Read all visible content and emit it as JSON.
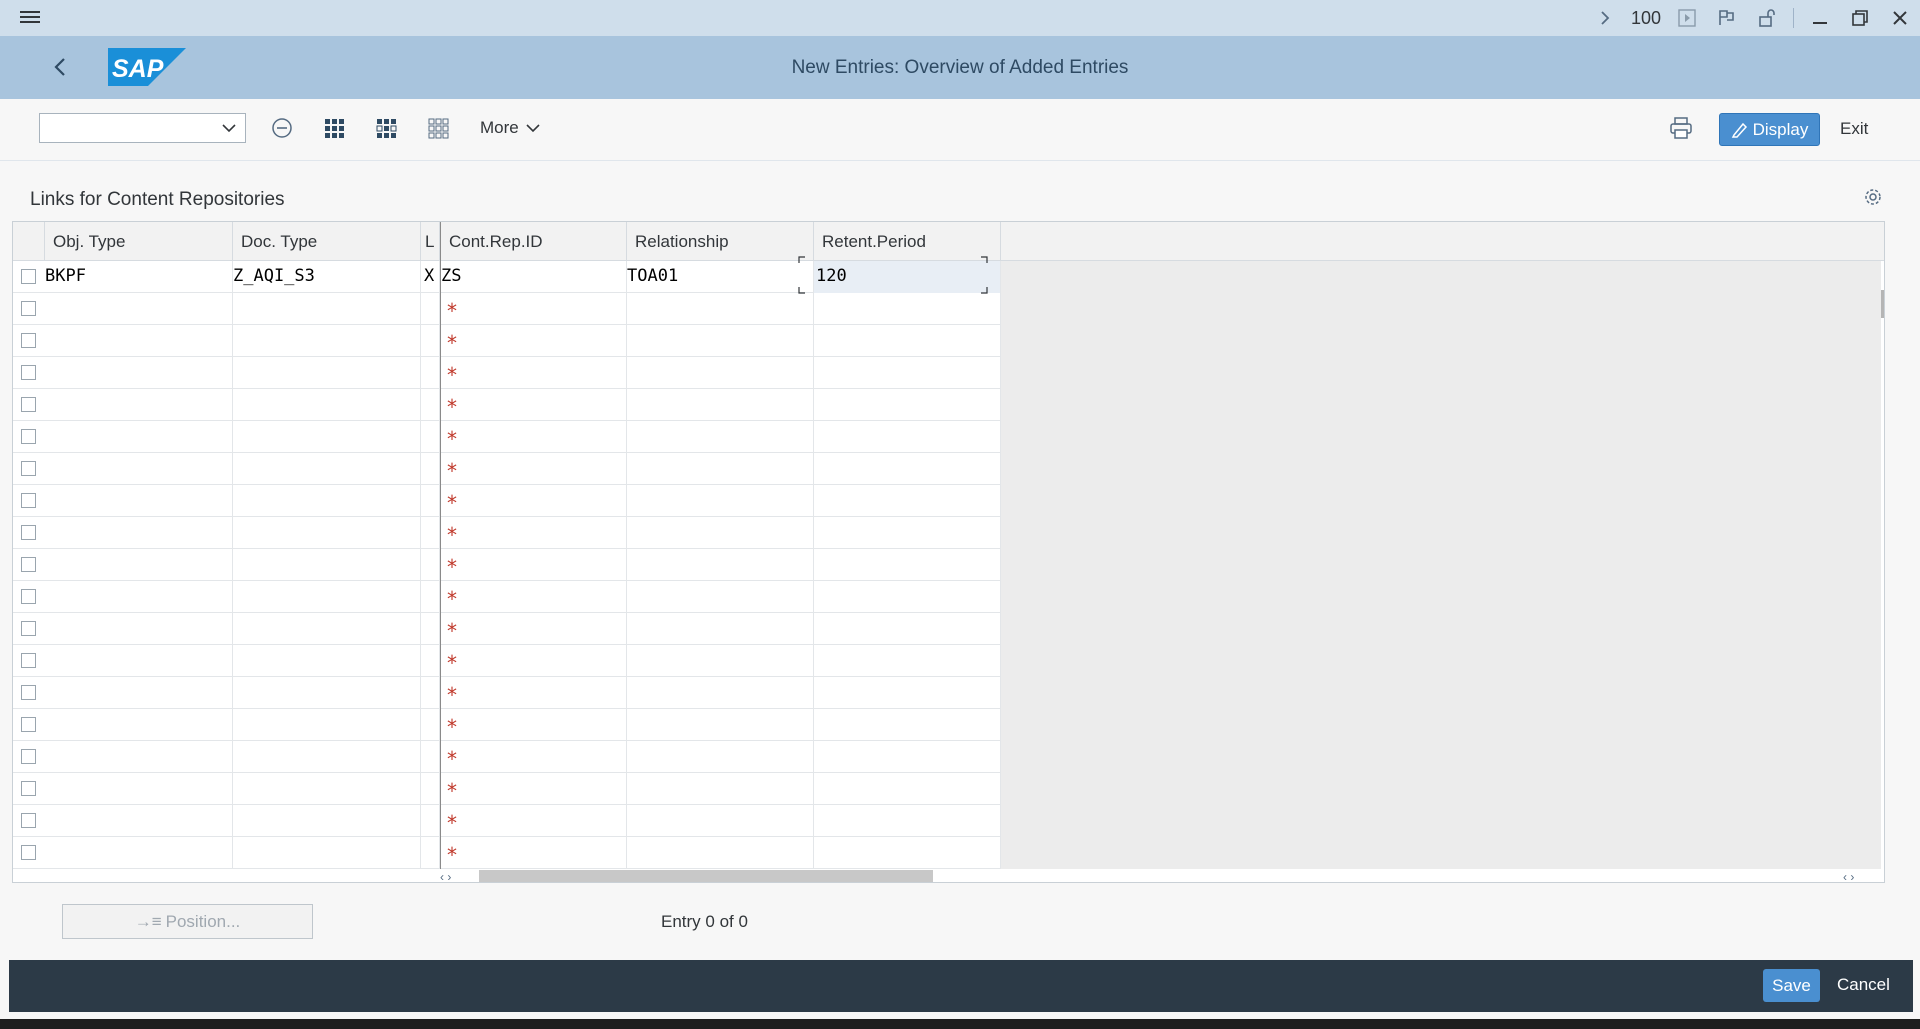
{
  "sysbar": {
    "zoom": "100"
  },
  "titlebar": {
    "title": "New Entries: Overview of Added Entries",
    "logo_text": "SAP"
  },
  "toolbar": {
    "dropdown_value": "",
    "more_label": "More",
    "display_label": "Display",
    "exit_label": "Exit"
  },
  "section": {
    "title": "Links for Content Repositories"
  },
  "table": {
    "columns": [
      "Obj. Type",
      "Doc. Type",
      "L",
      "Cont.Rep.ID",
      "Relationship",
      "Retent.Period"
    ],
    "first_row": {
      "obj_type": "BKPF",
      "doc_type": "Z_AQI_S3",
      "l": "X",
      "cont_rep_id": "ZS",
      "relationship": "TOA01",
      "retent_period": "120"
    },
    "required_marker": "*"
  },
  "position_label": "Position...",
  "entry_status": "Entry 0 of 0",
  "footer": {
    "save_label": "Save",
    "cancel_label": "Cancel"
  },
  "colors": {
    "accent": "#4a8fd0",
    "titlebar": "#a8c4dd",
    "footer": "#2c3a47",
    "required": "#c0392b"
  }
}
